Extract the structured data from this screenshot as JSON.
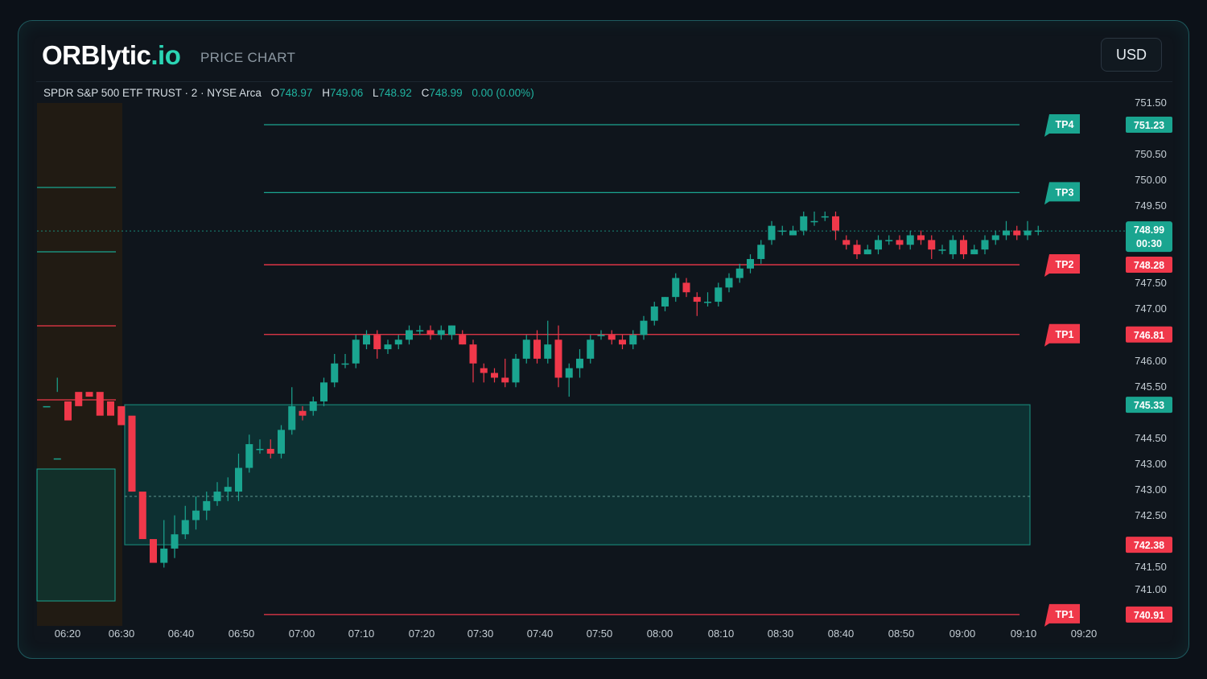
{
  "header": {
    "brand_main": "ORBlytic",
    "brand_tld": ".io",
    "subtitle": "PRICE CHART",
    "currency_button": "USD"
  },
  "legend": {
    "symbol": "SPDR S&P 500 ETF TRUST · 2 · NYSE Arca",
    "open_label": "O",
    "open": "748.97",
    "high_label": "H",
    "high": "749.06",
    "low_label": "L",
    "low": "748.92",
    "close_label": "C",
    "close": "748.99",
    "change": "0.00 (0.00%)"
  },
  "colors": {
    "up": "#1aa590",
    "down": "#f0384a",
    "accent": "#2bd4b4",
    "zone_fill": "#0d3a3a",
    "session_fill": "#241c12"
  },
  "chart_data": {
    "type": "candlestick",
    "y_ticks": [
      "751.50",
      "750.50",
      "750.00",
      "749.50",
      "747.50",
      "747.00",
      "746.00",
      "745.50",
      "744.50",
      "743.00",
      "743.00",
      "742.50",
      "741.50",
      "741.00"
    ],
    "x_ticks": [
      "06:20",
      "06:30",
      "06:40",
      "06:50",
      "07:00",
      "07:10",
      "07:20",
      "07:30",
      "07:40",
      "07:50",
      "08:00",
      "08:10",
      "08:30",
      "08:40",
      "08:50",
      "09:00",
      "09:10",
      "09:20"
    ],
    "levels": [
      {
        "label": "TP4",
        "price": "751.23",
        "kind": "up"
      },
      {
        "label": "TP3",
        "price": "",
        "kind": "up",
        "value": 749.8
      },
      {
        "label": "TP2",
        "price": "748.28",
        "kind": "down"
      },
      {
        "label": "TP1",
        "price": "746.81",
        "kind": "down"
      },
      {
        "label": "TP1",
        "price": "740.91",
        "kind": "down"
      }
    ],
    "current_price": {
      "price": "748.99",
      "countdown": "00:30"
    },
    "zone": {
      "top_price": "745.33",
      "bottom_price": "742.38",
      "mid": 743.4
    },
    "candles": [
      [
        745.3,
        745.3,
        744.2,
        744.2
      ],
      [
        744.2,
        744.2,
        745.6,
        745.9
      ],
      [
        745.4,
        745.0,
        745.7,
        745.7
      ],
      [
        745.6,
        745.3,
        745.9,
        745.9
      ],
      [
        745.6,
        745.5,
        745.8,
        745.8
      ],
      [
        745.6,
        745.1,
        745.8,
        745.8
      ],
      [
        745.4,
        745.1,
        745.5,
        745.5
      ],
      [
        745.3,
        744.9,
        745.4,
        745.4
      ],
      [
        745.1,
        743.5,
        745.2,
        745.2
      ],
      [
        743.5,
        742.5,
        743.6,
        743.6
      ],
      [
        742.5,
        742.0,
        742.6,
        742.6
      ],
      [
        742.0,
        742.3,
        741.9,
        742.9
      ],
      [
        742.3,
        742.6,
        742.1,
        743.0
      ],
      [
        742.6,
        742.9,
        742.5,
        743.2
      ],
      [
        742.9,
        743.1,
        742.7,
        743.4
      ],
      [
        743.1,
        743.3,
        742.9,
        743.5
      ],
      [
        743.3,
        743.5,
        743.2,
        743.7
      ],
      [
        743.5,
        743.6,
        743.3,
        743.8
      ],
      [
        743.5,
        744.0,
        743.3,
        744.3
      ],
      [
        744.0,
        744.5,
        743.9,
        744.7
      ],
      [
        744.4,
        744.4,
        744.3,
        744.6
      ],
      [
        744.4,
        744.3,
        744.2,
        744.6
      ],
      [
        744.3,
        744.8,
        744.2,
        744.9
      ],
      [
        744.8,
        745.3,
        744.7,
        745.7
      ],
      [
        745.2,
        745.1,
        745.0,
        745.3
      ],
      [
        745.2,
        745.4,
        745.1,
        745.5
      ],
      [
        745.4,
        745.8,
        745.3,
        745.9
      ],
      [
        745.8,
        746.2,
        745.7,
        746.4
      ],
      [
        746.2,
        746.2,
        746.1,
        746.4
      ],
      [
        746.2,
        746.7,
        746.1,
        746.8
      ],
      [
        746.6,
        746.8,
        746.5,
        746.9
      ],
      [
        746.8,
        746.5,
        746.3,
        746.9
      ],
      [
        746.5,
        746.6,
        746.4,
        746.7
      ],
      [
        746.6,
        746.7,
        746.5,
        746.8
      ],
      [
        746.7,
        746.9,
        746.6,
        747.0
      ],
      [
        746.9,
        746.9,
        746.8,
        747.0
      ],
      [
        746.9,
        746.8,
        746.7,
        747.0
      ],
      [
        746.8,
        746.9,
        746.7,
        747.0
      ],
      [
        746.8,
        747.0,
        746.7,
        747.0
      ],
      [
        746.8,
        746.6,
        746.6,
        746.9
      ],
      [
        746.6,
        746.2,
        745.8,
        746.7
      ],
      [
        746.1,
        746.0,
        745.8,
        746.2
      ],
      [
        746.0,
        745.9,
        745.8,
        746.1
      ],
      [
        745.9,
        745.8,
        745.7,
        746.3
      ],
      [
        745.8,
        746.3,
        745.7,
        746.4
      ],
      [
        746.3,
        746.7,
        746.2,
        746.8
      ],
      [
        746.7,
        746.3,
        746.2,
        746.9
      ],
      [
        746.3,
        746.6,
        746.2,
        747.1
      ],
      [
        746.7,
        745.9,
        745.7,
        747.0
      ],
      [
        745.9,
        746.1,
        745.5,
        746.2
      ],
      [
        746.1,
        746.3,
        745.9,
        746.5
      ],
      [
        746.3,
        746.7,
        746.2,
        746.8
      ],
      [
        746.8,
        746.8,
        746.7,
        746.9
      ],
      [
        746.8,
        746.7,
        746.6,
        746.9
      ],
      [
        746.7,
        746.6,
        746.5,
        746.8
      ],
      [
        746.6,
        746.8,
        746.5,
        746.9
      ],
      [
        746.8,
        747.1,
        746.7,
        747.2
      ],
      [
        747.1,
        747.4,
        747.0,
        747.5
      ],
      [
        747.4,
        747.6,
        747.3,
        747.6
      ],
      [
        747.6,
        748.0,
        747.5,
        748.1
      ],
      [
        747.9,
        747.7,
        747.6,
        748.0
      ],
      [
        747.6,
        747.5,
        747.2,
        747.7
      ],
      [
        747.5,
        747.5,
        747.4,
        747.7
      ],
      [
        747.5,
        747.8,
        747.4,
        747.9
      ],
      [
        747.8,
        748.0,
        747.7,
        748.1
      ],
      [
        748.0,
        748.2,
        747.9,
        748.3
      ],
      [
        748.2,
        748.4,
        748.1,
        748.5
      ],
      [
        748.4,
        748.7,
        748.3,
        748.8
      ],
      [
        748.8,
        749.1,
        748.7,
        749.2
      ],
      [
        749.0,
        749.0,
        748.9,
        749.1
      ],
      [
        748.9,
        749.0,
        748.9,
        749.1
      ],
      [
        749.0,
        749.3,
        748.9,
        749.4
      ],
      [
        749.2,
        749.2,
        749.1,
        749.4
      ],
      [
        749.3,
        749.3,
        749.2,
        749.4
      ],
      [
        749.3,
        749.0,
        748.8,
        749.4
      ],
      [
        748.8,
        748.7,
        748.6,
        748.9
      ],
      [
        748.7,
        748.5,
        748.4,
        748.8
      ],
      [
        748.5,
        748.6,
        748.5,
        748.7
      ],
      [
        748.6,
        748.8,
        748.5,
        748.9
      ],
      [
        748.8,
        748.8,
        748.7,
        748.9
      ],
      [
        748.8,
        748.7,
        748.6,
        748.9
      ],
      [
        748.7,
        748.9,
        748.6,
        749.0
      ],
      [
        748.9,
        748.8,
        748.7,
        749.0
      ],
      [
        748.8,
        748.6,
        748.4,
        748.9
      ],
      [
        748.6,
        748.6,
        748.5,
        748.7
      ],
      [
        748.5,
        748.8,
        748.4,
        748.9
      ],
      [
        748.8,
        748.5,
        748.4,
        748.9
      ],
      [
        748.5,
        748.6,
        748.5,
        748.7
      ],
      [
        748.6,
        748.8,
        748.5,
        748.9
      ],
      [
        748.8,
        748.9,
        748.7,
        749.0
      ],
      [
        748.9,
        749.0,
        748.8,
        749.2
      ],
      [
        749.0,
        748.9,
        748.8,
        749.1
      ],
      [
        748.9,
        749.0,
        748.8,
        749.2
      ],
      [
        749.0,
        749.0,
        748.9,
        749.1
      ]
    ]
  }
}
